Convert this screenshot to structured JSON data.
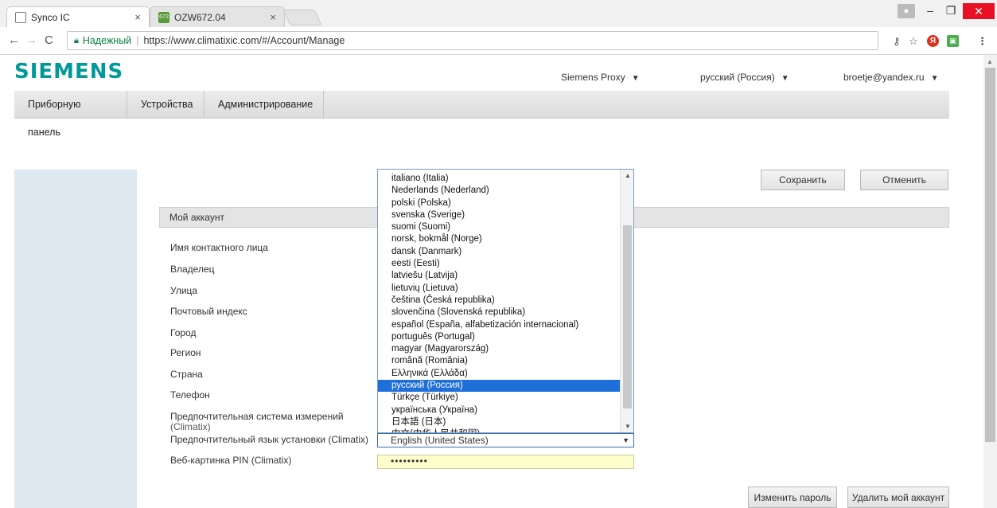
{
  "browser": {
    "tabs": [
      {
        "label": "Synco IC",
        "close": "×"
      },
      {
        "label": "OZW672.04",
        "close": "×",
        "favicon_text": "672"
      }
    ],
    "window_controls": {
      "minimize": "–",
      "maximize": "❐",
      "close": "✕"
    },
    "nav": {
      "back": "←",
      "forward": "→",
      "reload": "C"
    },
    "address": {
      "secure_label": "Надежный",
      "url": "https://www.climatixic.com/#/Account/Manage"
    },
    "toolbar_icons": {
      "key": "⚷",
      "star": "☆",
      "yandex": "Я",
      "extension": "▣",
      "menu": "⋮"
    }
  },
  "header": {
    "logo": "SIEMENS",
    "proxy_menu": "Siemens Proxy",
    "language_menu": "русский (Россия)",
    "user_menu": "broetje@yandex.ru",
    "caret": "▼"
  },
  "navbar": {
    "items": [
      {
        "label": "Приборную панель"
      },
      {
        "label": "Устройства"
      },
      {
        "label": "Администрирование"
      }
    ]
  },
  "actions": {
    "save": "Сохранить",
    "cancel": "Отменить",
    "change_password": "Изменить пароль",
    "delete_account": "Удалить мой аккаунт"
  },
  "account": {
    "section_title": "Мой аккаунт",
    "fields": {
      "contact_name": "Имя контактного лица",
      "owner": "Владелец",
      "street": "Улица",
      "postal_code": "Почтовый индекс",
      "city": "Город",
      "region": "Регион",
      "country": "Страна",
      "phone": "Телефон",
      "units_system_1": "Предпочтительная система измерений",
      "units_system_2": "(Climatix)",
      "install_language": "Предпочтительный язык установки (Climatix)",
      "web_pin": "Веб-картинка PIN (Climatix)"
    },
    "install_language_value": "English (United States)",
    "web_pin_value": "•••••••••"
  },
  "language_dropdown": {
    "selected": "русский (Россия)",
    "options": [
      "italiano (Italia)",
      "Nederlands (Nederland)",
      "polski (Polska)",
      "svenska (Sverige)",
      "suomi (Suomi)",
      "norsk, bokmål (Norge)",
      "dansk (Danmark)",
      "eesti (Eesti)",
      "latviešu (Latvija)",
      "lietuvių (Lietuva)",
      "čeština (Česká republika)",
      "slovenčina (Slovenská republika)",
      "español (España, alfabetización internacional)",
      "português (Portugal)",
      "magyar (Magyarország)",
      "română (România)",
      "Ελληνικά (Ελλάδα)",
      "русский (Россия)",
      "Türkçe (Türkiye)",
      "українська (Україна)",
      "日本語 (日本)",
      "中文(中华人民共和国)"
    ]
  },
  "colors": {
    "brand": "#009999",
    "selection": "#1e6fd9",
    "sidebar": "#dde8f0",
    "close_button": "#e81123"
  }
}
